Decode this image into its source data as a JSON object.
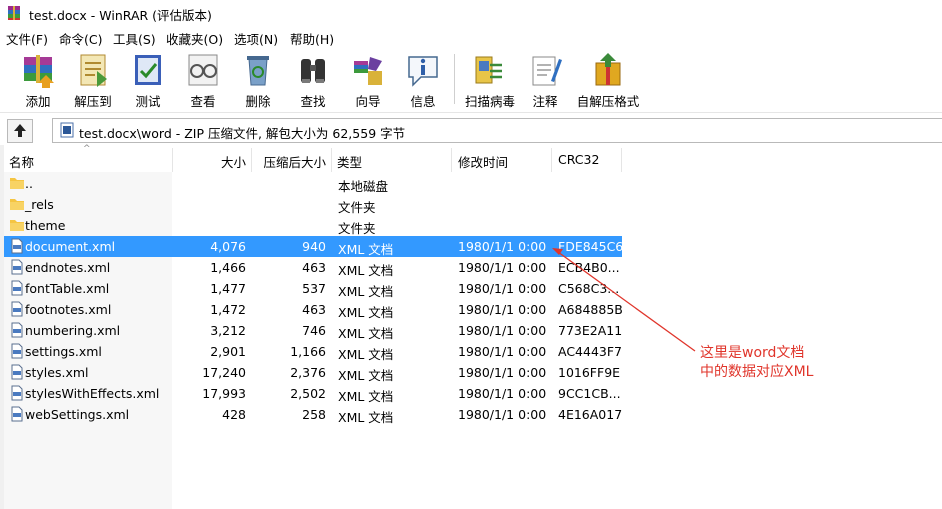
{
  "window": {
    "title": "test.docx - WinRAR (评估版本)"
  },
  "menu": [
    "文件(F)",
    "命令(C)",
    "工具(S)",
    "收藏夹(O)",
    "选项(N)",
    "帮助(H)"
  ],
  "toolbar": [
    {
      "label": "添加",
      "icon": "add-books-icon"
    },
    {
      "label": "解压到",
      "icon": "extract-folder-icon"
    },
    {
      "label": "测试",
      "icon": "test-check-icon"
    },
    {
      "label": "查看",
      "icon": "view-glasses-icon"
    },
    {
      "label": "删除",
      "icon": "delete-recycle-icon"
    },
    {
      "label": "查找",
      "icon": "find-binoculars-icon"
    },
    {
      "label": "向导",
      "icon": "wizard-icon"
    },
    {
      "label": "信息",
      "icon": "info-icon"
    },
    {
      "label": "扫描病毒",
      "icon": "virus-scan-icon"
    },
    {
      "label": "注释",
      "icon": "comment-icon"
    },
    {
      "label": "自解压格式",
      "icon": "sfx-icon"
    }
  ],
  "address": {
    "path": "test.docx\\word - ZIP 压缩文件, 解包大小为 62,559 字节"
  },
  "columns": {
    "name": "名称",
    "size": "大小",
    "packed": "压缩后大小",
    "type": "类型",
    "modified": "修改时间",
    "crc": "CRC32"
  },
  "files": [
    {
      "name": "..",
      "size": "",
      "packed": "",
      "type": "本地磁盘",
      "modified": "",
      "crc": "",
      "kind": "folder"
    },
    {
      "name": "_rels",
      "size": "",
      "packed": "",
      "type": "文件夹",
      "modified": "",
      "crc": "",
      "kind": "folder"
    },
    {
      "name": "theme",
      "size": "",
      "packed": "",
      "type": "文件夹",
      "modified": "",
      "crc": "",
      "kind": "folder"
    },
    {
      "name": "document.xml",
      "size": "4,076",
      "packed": "940",
      "type": "XML 文档",
      "modified": "1980/1/1 0:00",
      "crc": "FDE845C6",
      "kind": "xml",
      "selected": true
    },
    {
      "name": "endnotes.xml",
      "size": "1,466",
      "packed": "463",
      "type": "XML 文档",
      "modified": "1980/1/1 0:00",
      "crc": "ECB4B0...",
      "kind": "xml"
    },
    {
      "name": "fontTable.xml",
      "size": "1,477",
      "packed": "537",
      "type": "XML 文档",
      "modified": "1980/1/1 0:00",
      "crc": "C568C3...",
      "kind": "xml"
    },
    {
      "name": "footnotes.xml",
      "size": "1,472",
      "packed": "463",
      "type": "XML 文档",
      "modified": "1980/1/1 0:00",
      "crc": "A684885B",
      "kind": "xml"
    },
    {
      "name": "numbering.xml",
      "size": "3,212",
      "packed": "746",
      "type": "XML 文档",
      "modified": "1980/1/1 0:00",
      "crc": "773E2A11",
      "kind": "xml"
    },
    {
      "name": "settings.xml",
      "size": "2,901",
      "packed": "1,166",
      "type": "XML 文档",
      "modified": "1980/1/1 0:00",
      "crc": "AC4443F7",
      "kind": "xml"
    },
    {
      "name": "styles.xml",
      "size": "17,240",
      "packed": "2,376",
      "type": "XML 文档",
      "modified": "1980/1/1 0:00",
      "crc": "1016FF9E",
      "kind": "xml"
    },
    {
      "name": "stylesWithEffects.xml",
      "size": "17,993",
      "packed": "2,502",
      "type": "XML 文档",
      "modified": "1980/1/1 0:00",
      "crc": "9CC1CB...",
      "kind": "xml"
    },
    {
      "name": "webSettings.xml",
      "size": "428",
      "packed": "258",
      "type": "XML 文档",
      "modified": "1980/1/1 0:00",
      "crc": "4E16A017",
      "kind": "xml"
    }
  ],
  "annotation": {
    "line1": "这里是word文档",
    "line2": "中的数据对应XML",
    "color": "#e0352b"
  },
  "colors": {
    "selection": "#3399ff",
    "folder": "#f5c542"
  }
}
